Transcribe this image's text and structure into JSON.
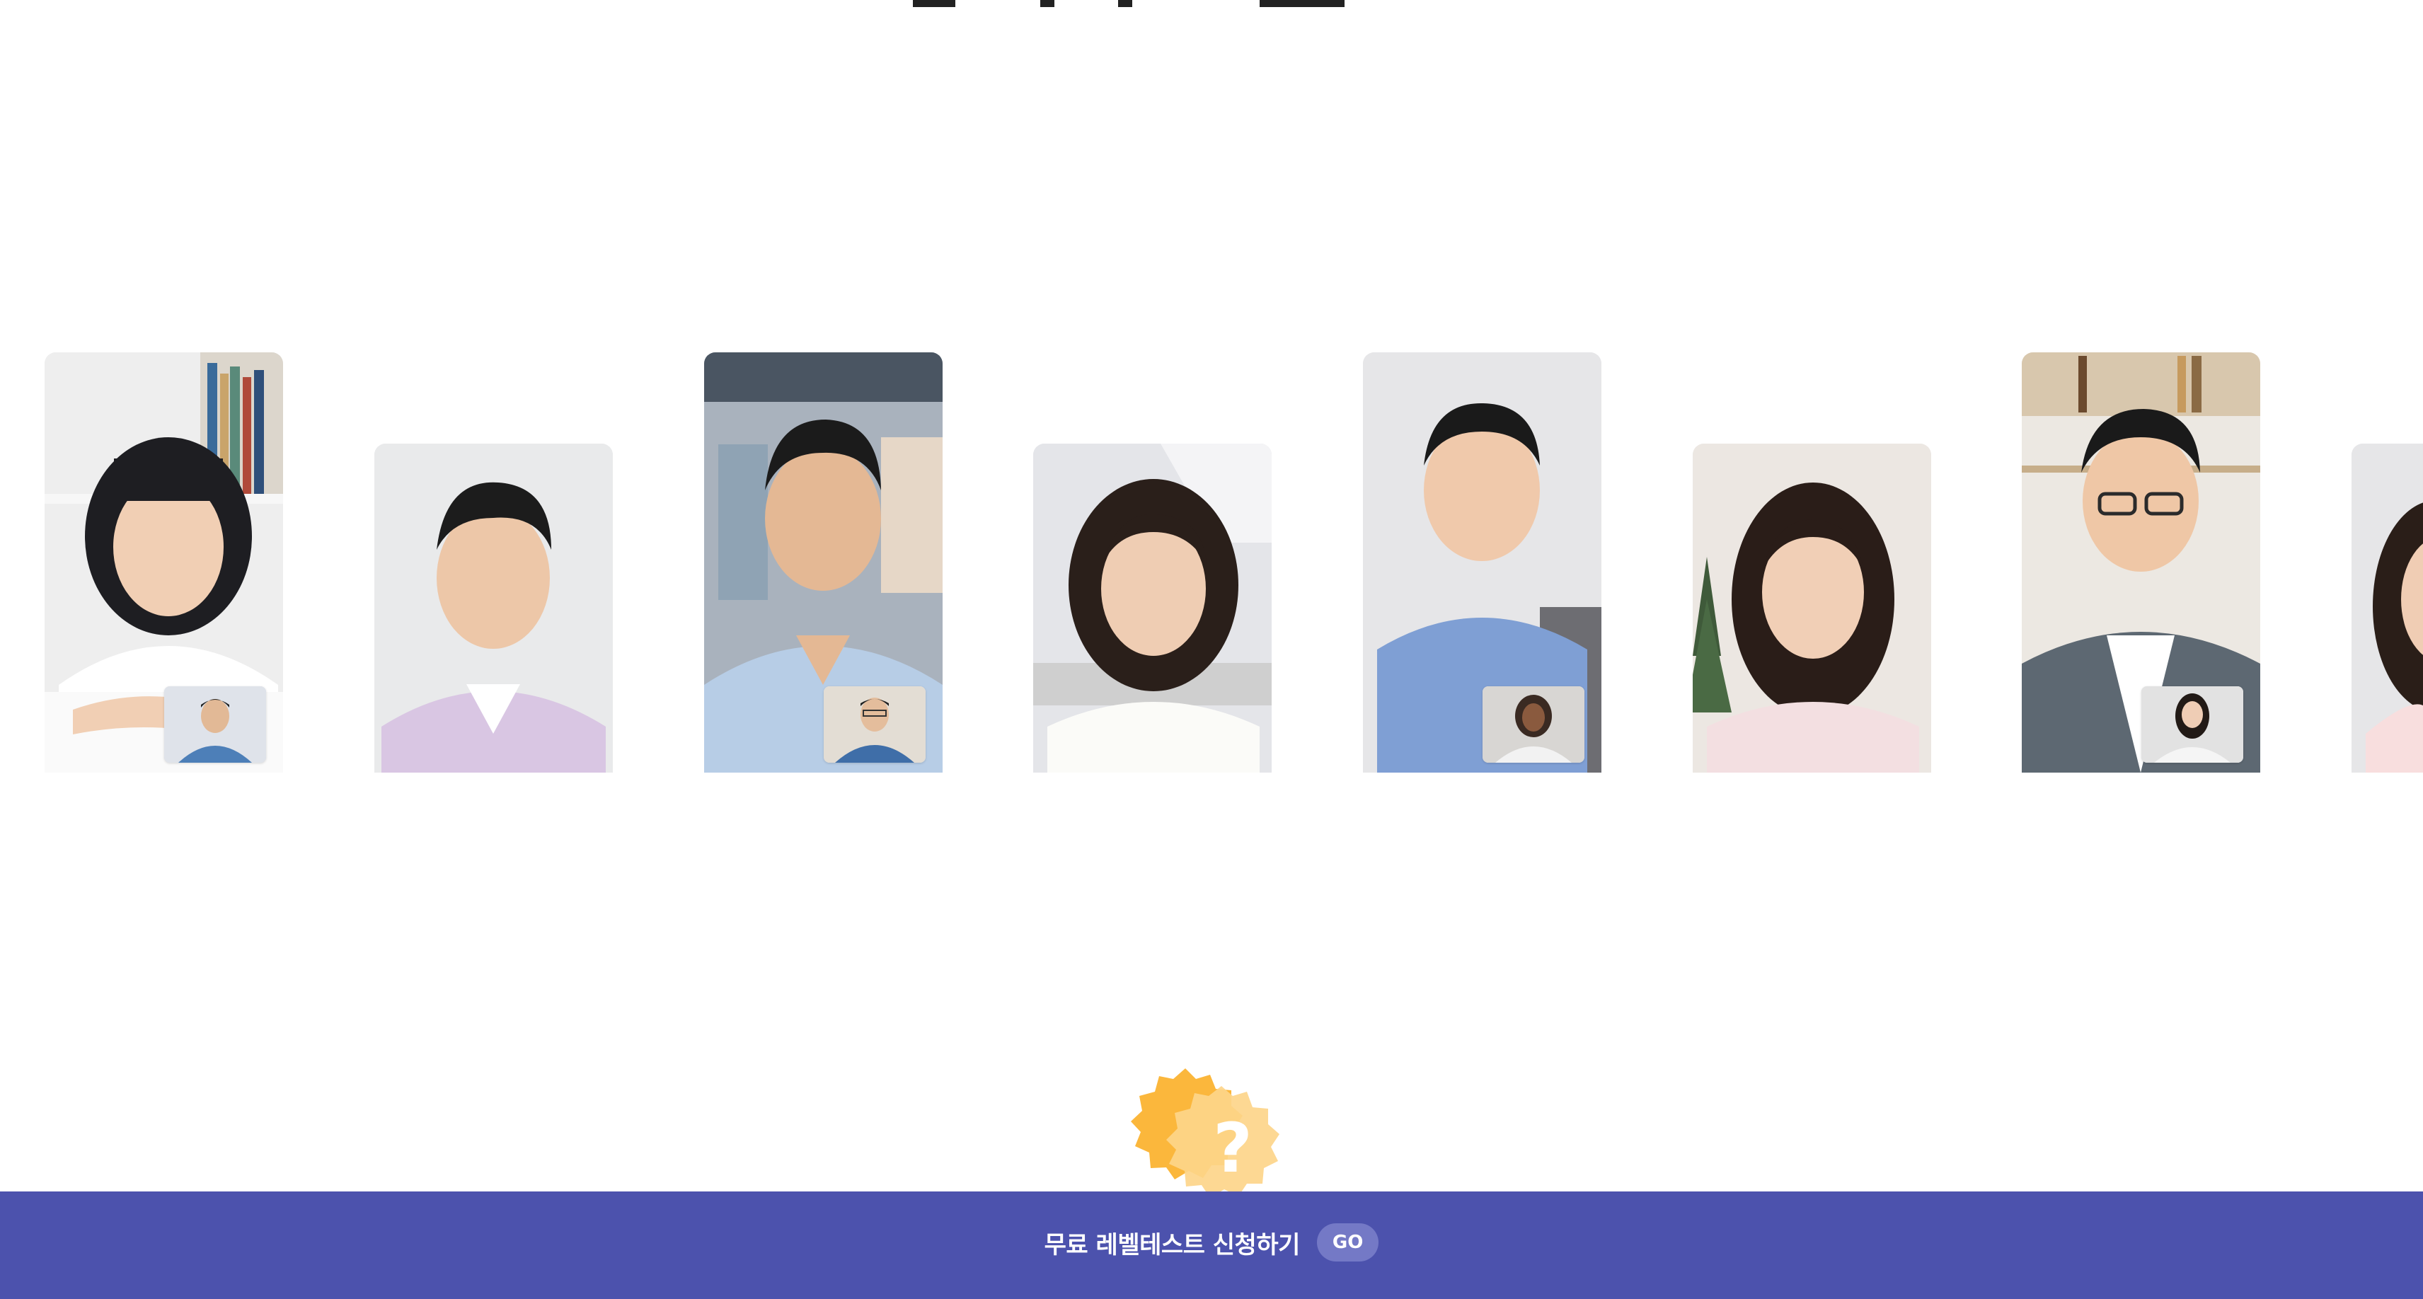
{
  "cta": {
    "label": "무료 레벨테스트 신청하기",
    "button_label": "GO",
    "bar_color": "#4c52ad"
  },
  "badge": {
    "symbol": "?",
    "color": "#fbb73c"
  },
  "carousel": {
    "cards": [
      {
        "subject": "girl-student",
        "has_pip": true
      },
      {
        "subject": "young-man",
        "has_pip": false
      },
      {
        "subject": "middle-aged-man",
        "has_pip": true
      },
      {
        "subject": "young-woman",
        "has_pip": false
      },
      {
        "subject": "young-boy",
        "has_pip": true
      },
      {
        "subject": "young-woman",
        "has_pip": false
      },
      {
        "subject": "young-man-glasses",
        "has_pip": true
      },
      {
        "subject": "partial-woman",
        "has_pip": false
      }
    ]
  }
}
